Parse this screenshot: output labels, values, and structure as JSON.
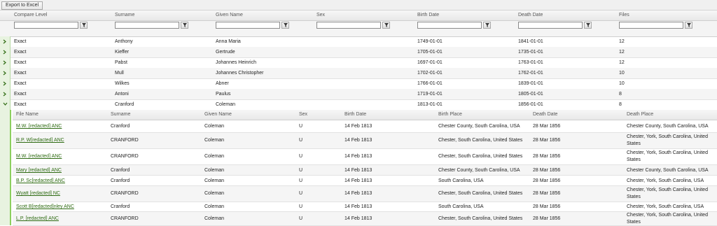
{
  "toolbar": {
    "export_label": "Export to Excel"
  },
  "columns": [
    "Compare Level",
    "Surname",
    "Given Name",
    "Sex",
    "Birth Date",
    "Death Date",
    "Files"
  ],
  "rows": [
    {
      "compare": "Exact",
      "surname": "Anthony",
      "given": "Anna Maria",
      "sex": "",
      "birth": "1749-01-01",
      "death": "1841-01-01",
      "files": "12"
    },
    {
      "compare": "Exact",
      "surname": "Kieffer",
      "given": "Gertrude",
      "sex": "",
      "birth": "1705-01-01",
      "death": "1735-01-01",
      "files": "12"
    },
    {
      "compare": "Exact",
      "surname": "Pabst",
      "given": "Johannes Heinrich",
      "sex": "",
      "birth": "1697-01-01",
      "death": "1763-01-01",
      "files": "12"
    },
    {
      "compare": "Exact",
      "surname": "Mull",
      "given": "Johannes Christopher",
      "sex": "",
      "birth": "1702-01-01",
      "death": "1762-01-01",
      "files": "10"
    },
    {
      "compare": "Exact",
      "surname": "Wilkes",
      "given": "Abner",
      "sex": "",
      "birth": "1766-01-01",
      "death": "1839-01-01",
      "files": "10"
    },
    {
      "compare": "Exact",
      "surname": "Antoni",
      "given": "Paulus",
      "sex": "",
      "birth": "1719-01-01",
      "death": "1805-01-01",
      "files": "8"
    },
    {
      "compare": "Exact",
      "surname": "Cranford",
      "given": "Coleman",
      "sex": "",
      "birth": "1813-01-01",
      "death": "1856-01-01",
      "files": "8"
    }
  ],
  "detail_columns": [
    "File Name",
    "Surname",
    "Given Name",
    "Sex",
    "Birth Date",
    "Birth Place",
    "Death Date",
    "Death Place"
  ],
  "detail_rows": [
    {
      "file": "M.W. [redacted] ANC",
      "surname": "Cranford",
      "given": "Coleman",
      "sex": "U",
      "birth": "14 Feb 1813",
      "birth_place": "Chester County, South Carolina, USA",
      "death": "28 Mar 1856",
      "death_place": "Chester County, South Carolina, USA"
    },
    {
      "file": "R.P. W[redacted] ANC",
      "surname": "CRANFORD",
      "given": "Coleman",
      "sex": "U",
      "birth": "14 Feb 1813",
      "birth_place": "Chester, South Carolina, United States",
      "death": "28 Mar 1856",
      "death_place": "Chester, York, South Carolina, United States"
    },
    {
      "file": "M.W. [redacted] ANC",
      "surname": "CRANFORD",
      "given": "Coleman",
      "sex": "U",
      "birth": "14 Feb 1813",
      "birth_place": "Chester, South Carolina, United States",
      "death": "28 Mar 1856",
      "death_place": "Chester, York, South Carolina, United States"
    },
    {
      "file": "Mary [redacted] ANC",
      "surname": "Cranford",
      "given": "Coleman",
      "sex": "U",
      "birth": "14 Feb 1813",
      "birth_place": "Chester County, South Carolina, USA",
      "death": "28 Mar 1856",
      "death_place": "Chester County, South Carolina, USA"
    },
    {
      "file": "B.P. Sc[redacted] ANC",
      "surname": "Cranford",
      "given": "Coleman",
      "sex": "U",
      "birth": "14 Feb 1813",
      "birth_place": "South Carolina, USA",
      "death": "28 Mar 1856",
      "death_place": "Chester, York, South Carolina, USA"
    },
    {
      "file": "Wyatt [redacted] NC",
      "surname": "CRANFORD",
      "given": "Coleman",
      "sex": "U",
      "birth": "14 Feb 1813",
      "birth_place": "Chester, South Carolina, United States",
      "death": "28 Mar 1856",
      "death_place": "Chester, York, South Carolina, United States"
    },
    {
      "file": "Scott B[redacted]nley ANC",
      "surname": "Cranford",
      "given": "Coleman",
      "sex": "U",
      "birth": "14 Feb 1813",
      "birth_place": "South Carolina, USA",
      "death": "28 Mar 1856",
      "death_place": "Chester, York, South Carolina, USA"
    },
    {
      "file": "L.P. [redacted] ANC",
      "surname": "CRANFORD",
      "given": "Coleman",
      "sex": "U",
      "birth": "14 Feb 1813",
      "birth_place": "Chester, South Carolina, United States",
      "death": "28 Mar 1856",
      "death_place": "Chester, York, South Carolina, United States"
    }
  ],
  "colors": {
    "link": "#2e6b12",
    "expander_bg": "#e8f3e0",
    "detail_border": "#8ccf5e"
  },
  "icons": {
    "filter": "filter-icon",
    "expand": "chevron-right-icon",
    "collapse": "chevron-down-icon"
  }
}
